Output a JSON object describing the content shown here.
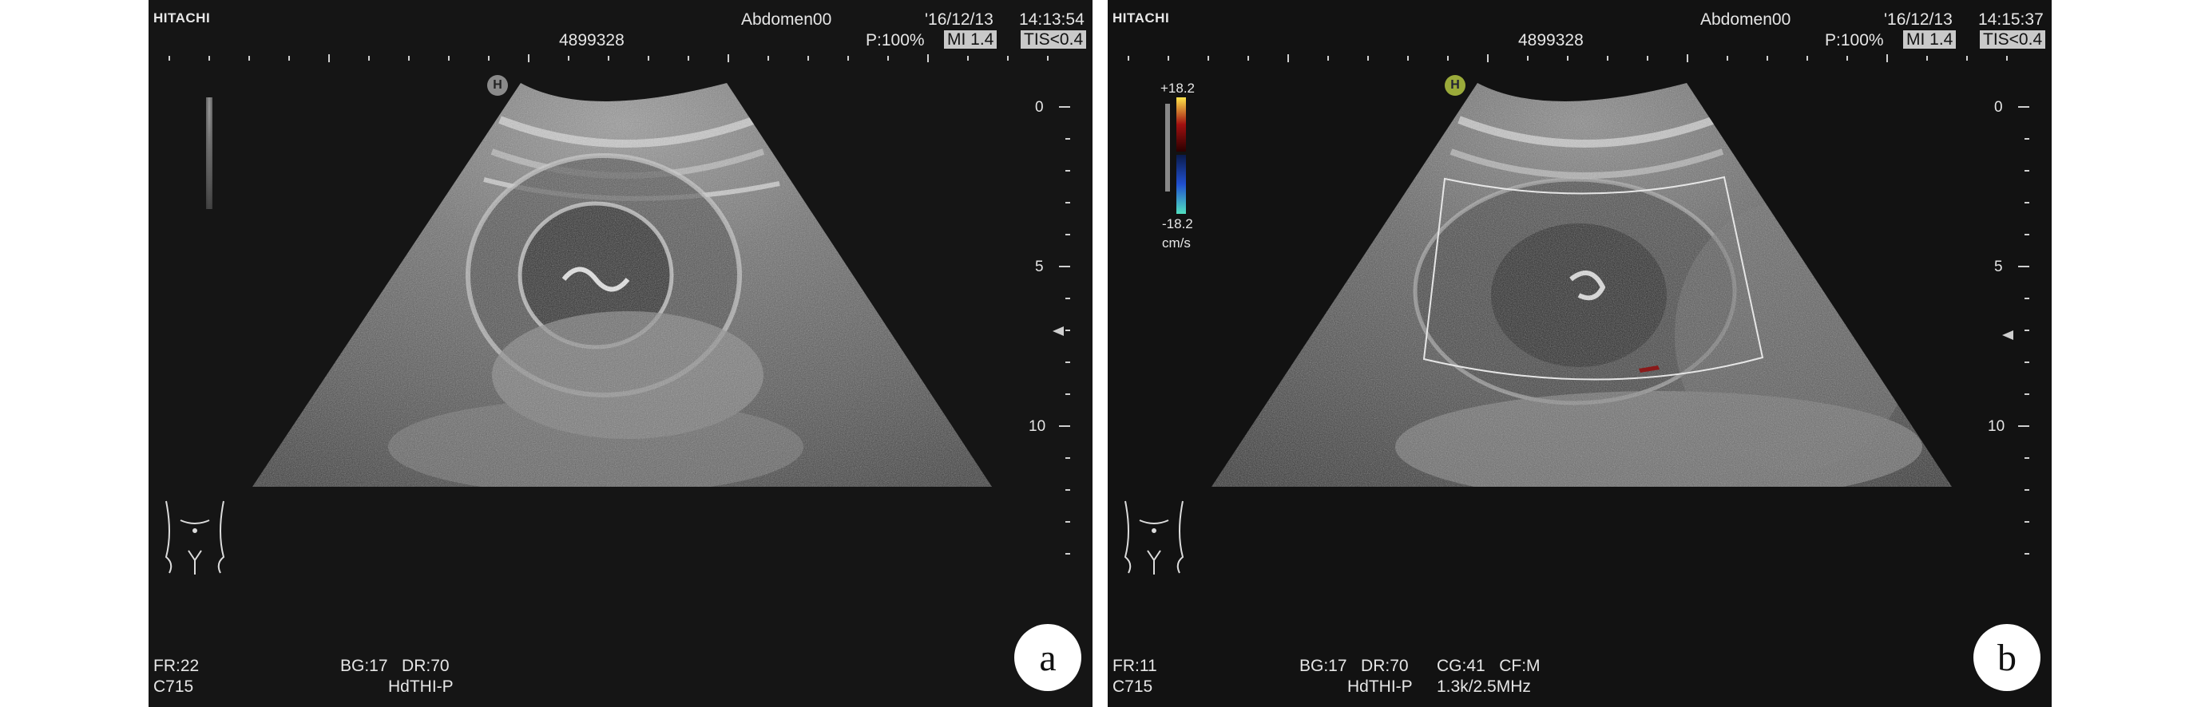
{
  "panels": [
    {
      "brand": "HITACHI",
      "preset": "Abdomen00",
      "date": "'16/12/13",
      "time": "14:13:54",
      "patient_id": "4899328",
      "power": "P:100%",
      "mi": "MI 1.4",
      "tis": "TIS<0.4",
      "frame_rate": "FR:22",
      "probe": "C715",
      "bg_dr": "BG:17   DR:70",
      "mode": "HdTHI-P",
      "depth_labels": [
        "0",
        "5",
        "10"
      ],
      "orientation_marker": "H",
      "label": "a"
    },
    {
      "brand": "HITACHI",
      "preset": "Abdomen00",
      "date": "'16/12/13",
      "time": "14:15:37",
      "patient_id": "4899328",
      "power": "P:100%",
      "mi": "MI 1.4",
      "tis": "TIS<0.4",
      "frame_rate": "FR:11",
      "probe": "C715",
      "bg_dr": "BG:17   DR:70",
      "cg_cf": "CG:41   CF:M",
      "mode": "HdTHI-P",
      "freq": "1.3k/2.5MHz",
      "depth_labels": [
        "0",
        "5",
        "10"
      ],
      "orientation_marker": "H",
      "color_scale": {
        "max": "+18.2",
        "min": "-18.2",
        "unit": "cm/s"
      },
      "label": "b"
    }
  ],
  "colors": {
    "background": "#151515",
    "text": "#e6e6e6",
    "marker_a": "#8a8a8a",
    "marker_b": "#9aaa3a"
  }
}
